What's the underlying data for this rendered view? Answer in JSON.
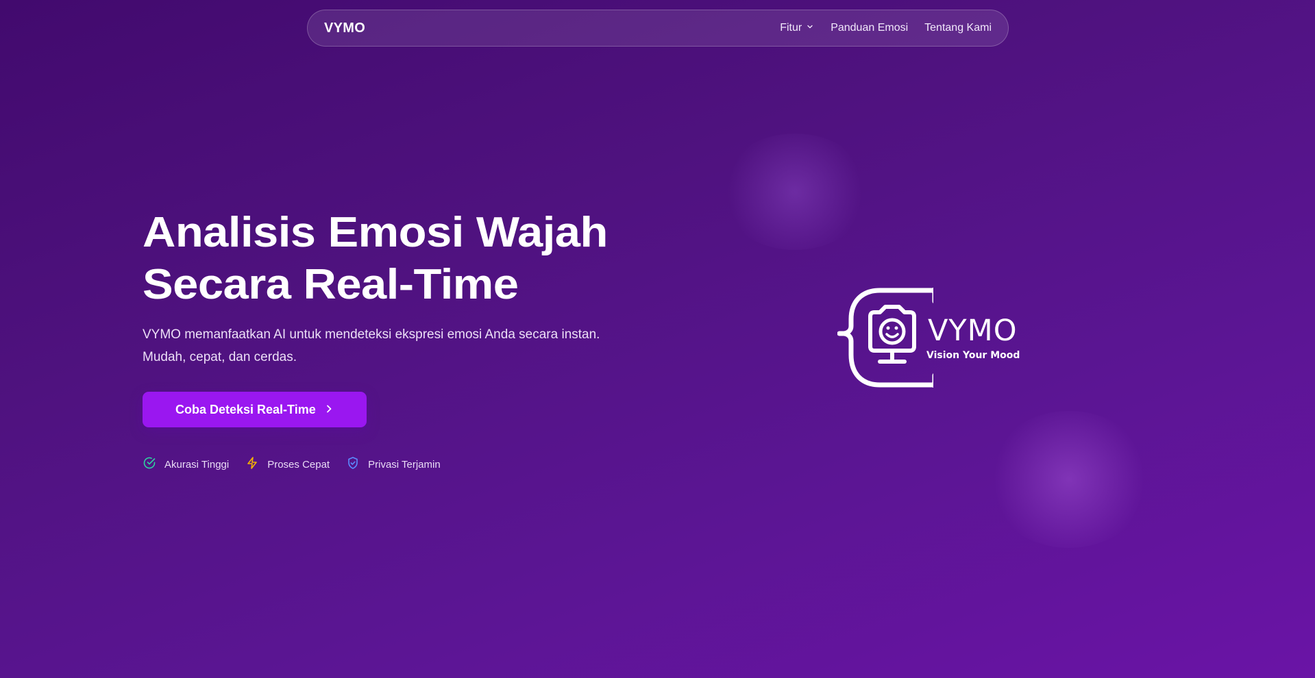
{
  "colors": {
    "background_start": "#420a6e",
    "background_end": "#6a14a6",
    "accent_button": "#9a17f0",
    "check_icon": "#2ed3a0",
    "bolt_icon": "#f5b400",
    "shield_icon": "#5b8cff"
  },
  "navbar": {
    "brand": "VYMO",
    "links": [
      {
        "label": "Fitur",
        "icon": "chevron-down-icon"
      },
      {
        "label": "Panduan Emosi"
      },
      {
        "label": "Tentang Kami"
      }
    ]
  },
  "hero": {
    "title_line1": "Analisis Emosi Wajah",
    "title_line2": "Secara Real-Time",
    "subtitle": "VYMO memanfaatkan AI untuk mendeteksi ekspresi emosi Anda secara instan. Mudah, cepat, dan cerdas.",
    "cta_label": "Coba Deteksi Real-Time",
    "cta_icon": "chevron-right-icon"
  },
  "features": [
    {
      "label": "Akurasi Tinggi",
      "icon": "check-circle-icon"
    },
    {
      "label": "Proses Cepat",
      "icon": "lightning-icon"
    },
    {
      "label": "Privasi Terjamin",
      "icon": "shield-check-icon"
    }
  ],
  "logo": {
    "wordmark": "VYMO",
    "tagline": "Vision Your Mood",
    "icon": "camera-face-icon"
  }
}
